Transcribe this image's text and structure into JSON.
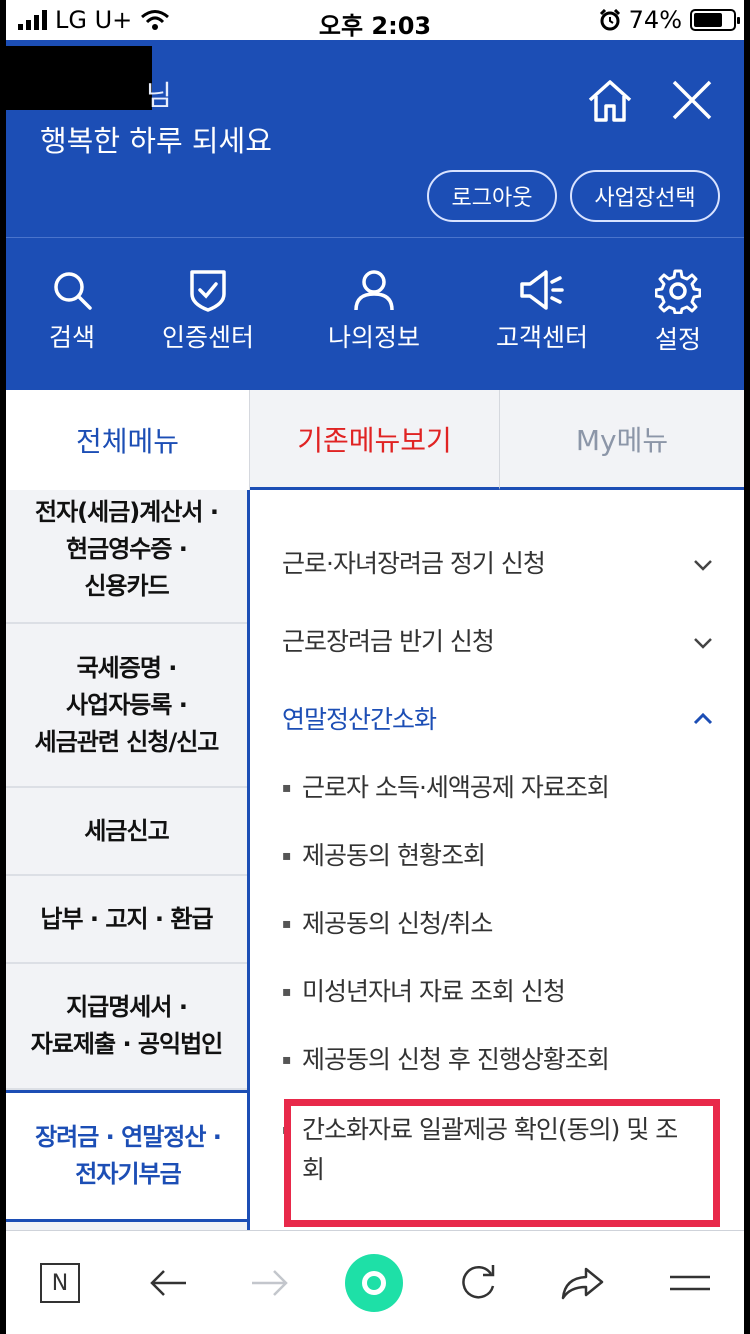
{
  "status_bar": {
    "carrier": "LG U+",
    "time": "오후 2:03",
    "battery": "74%",
    "battery_level": 0.74
  },
  "header": {
    "greeting_suffix": "님",
    "greeting": "행복한 하루 되세요",
    "logout_label": "로그아웃",
    "business_select_label": "사업장선택",
    "background_color": "#1c4eb5",
    "quick_menu": [
      {
        "label": "검색",
        "icon": "search-icon"
      },
      {
        "label": "인증센터",
        "icon": "shield-check-icon"
      },
      {
        "label": "나의정보",
        "icon": "user-icon"
      },
      {
        "label": "고객센터",
        "icon": "megaphone-icon"
      },
      {
        "label": "설정",
        "icon": "gear-icon"
      }
    ]
  },
  "tabs": [
    {
      "label": "전체메뉴",
      "active": true,
      "color": "#1c4eb5"
    },
    {
      "label": "기존메뉴보기",
      "active": false,
      "color": "#e02323"
    },
    {
      "label": "My메뉴",
      "active": false,
      "color": "#8c96a8"
    }
  ],
  "left_menu": [
    {
      "line1": "전자(세금)계산서 ·",
      "line2": "현금영수증 ·",
      "line3": "신용카드"
    },
    {
      "line1": "국세증명 ·",
      "line2": "사업자등록 ·",
      "line3": "세금관련 신청/신고"
    },
    {
      "line1": "세금신고"
    },
    {
      "line1": "납부 · 고지 · 환급"
    },
    {
      "line1": "지급명세서 ·",
      "line2": "자료제출 · 공익법인"
    },
    {
      "line1": "장려금 · 연말정산 ·",
      "line2": "전자기부금",
      "active": true
    }
  ],
  "right_menu": {
    "sections": [
      {
        "label": "근로·자녀장려금 정기 신청",
        "expanded": false
      },
      {
        "label": "근로장려금 반기 신청",
        "expanded": false
      },
      {
        "label": "연말정산간소화",
        "expanded": true
      }
    ],
    "sub_items": [
      "근로자 소득·세액공제 자료조회",
      "제공동의 현황조회",
      "제공동의 신청/취소",
      "미성년자녀 자료 조회 신청",
      "제공동의 신청 후 진행상황조회",
      "간소화자료 일괄제공 확인(동의) 및 조회"
    ],
    "highlight_color": "#e8294a"
  },
  "bottom_bar": {
    "tabs_label": "N",
    "items": [
      "tabs-icon",
      "back-icon",
      "forward-icon",
      "home-ball-icon",
      "refresh-icon",
      "share-icon",
      "menu-icon"
    ]
  }
}
